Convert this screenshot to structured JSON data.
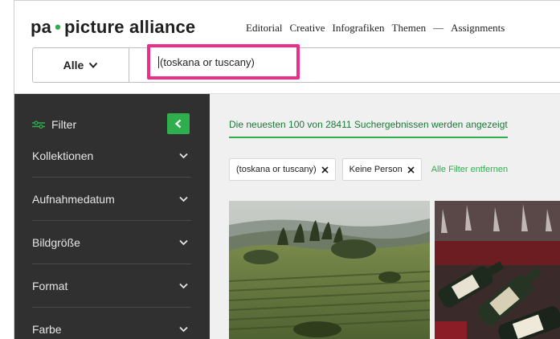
{
  "brand": {
    "name_left": "pa",
    "separator": "•",
    "name_right": "picture alliance"
  },
  "nav": [
    "Editorial",
    "Creative",
    "Infografiken",
    "Themen",
    "—",
    "Assignments"
  ],
  "search": {
    "scope_label": "Alle",
    "query": "(toskana or tuscany)"
  },
  "sidebar": {
    "filter_label": "Filter",
    "facets": [
      "Kollektionen",
      "Aufnahmedatum",
      "Bildgröße",
      "Format",
      "Farbe"
    ]
  },
  "results": {
    "summary": "Die neuesten 100 von 28411 Suchergebnissen werden angezeigt",
    "chips": [
      "(toskana or tuscany)",
      "Keine Person"
    ],
    "clear_all": "Alle Filter entfernen"
  },
  "colors": {
    "accent_green": "#2fae4e",
    "highlight_pink": "#ec2d8a",
    "sidebar_bg": "#303030"
  }
}
